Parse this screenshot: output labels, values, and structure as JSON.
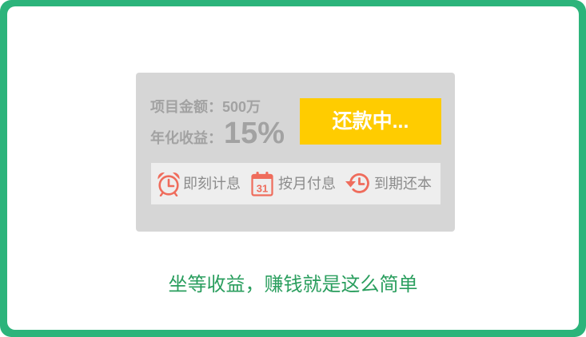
{
  "colors": {
    "frame": "#2cb47b",
    "card": "#d6d6d6",
    "strip": "#eeeeee",
    "button": "#ffcc00",
    "button_text": "#ffffff",
    "icon": "#ef6c5c",
    "slogan": "#2a9e5e",
    "card_text": "#a2a2a2",
    "feature_text": "#8c8c8c"
  },
  "card": {
    "amount_label": "项目金额：",
    "amount_value": "500万",
    "rate_label": "年化收益：",
    "rate_value": "15%",
    "status_button": "还款中...",
    "features": [
      {
        "icon": "alarm-clock-icon",
        "label": "即刻计息"
      },
      {
        "icon": "calendar-icon",
        "icon_text": "31",
        "label": "按月付息"
      },
      {
        "icon": "history-icon",
        "label": "到期还本"
      }
    ]
  },
  "slogan": "坐等收益，赚钱就是这么简单"
}
